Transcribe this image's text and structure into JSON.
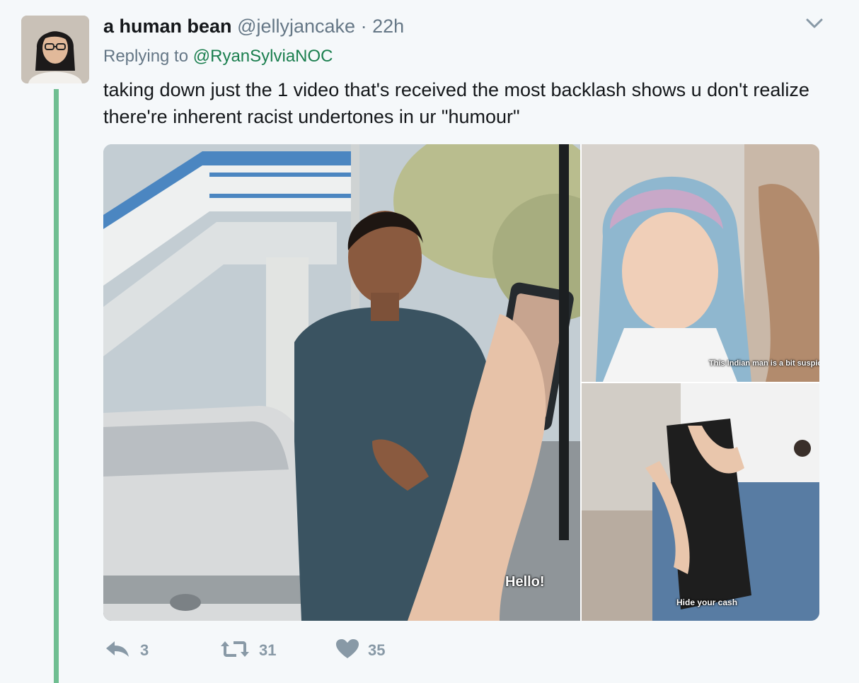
{
  "tweet": {
    "display_name": "a human bean",
    "handle": "@jellyjancake",
    "separator": "·",
    "time": "22h",
    "replying_prefix": "Replying to",
    "replying_to": "@RyanSylviaNOC",
    "text": "taking down just the 1 video that's received the most backlash shows u don't realize there're inherent racist undertones in ur \"humour\"",
    "media": {
      "main_caption": "Hello!",
      "top_caption": "This Indian man is a bit suspici",
      "bottom_caption": "Hide your cash"
    },
    "actions": {
      "reply_count": "3",
      "retweet_count": "31",
      "like_count": "35"
    }
  },
  "colors": {
    "background": "#f5f8fa",
    "thread_line": "#6fbe91",
    "reply_link": "#1b7f4f",
    "muted": "#657786",
    "action_icon": "#8899a6"
  },
  "icons": [
    "chevron-down-icon",
    "reply-icon",
    "retweet-icon",
    "heart-icon"
  ]
}
